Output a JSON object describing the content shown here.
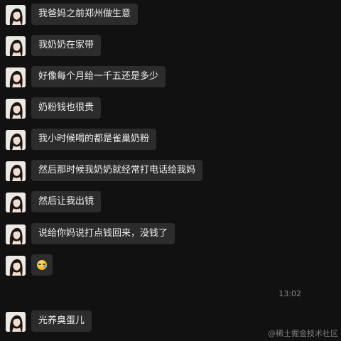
{
  "conversation": {
    "messages": [
      {
        "text": "我爸妈之前郑州做生意"
      },
      {
        "text": "我奶奶在家带"
      },
      {
        "text": "好像每个月给一千五还是多少"
      },
      {
        "text": "奶粉钱也很贵"
      },
      {
        "text": "我小时候喝的都是雀巢奶粉"
      },
      {
        "text": "然后那时候我奶奶就经常打电话给我妈"
      },
      {
        "text": "然后让我出镜"
      },
      {
        "text": "说给你妈说打点钱回来，没钱了"
      },
      {
        "emoji": "sweat-smile-icon"
      },
      {
        "text": "光养臭蛋儿"
      }
    ],
    "timestamp": "13:02"
  },
  "watermark": "@稀土掘金技术社区",
  "colors": {
    "background": "#111111",
    "bubble": "#2c2c2c",
    "text": "#f2f2f2",
    "timestamp": "#8a8a8a"
  }
}
